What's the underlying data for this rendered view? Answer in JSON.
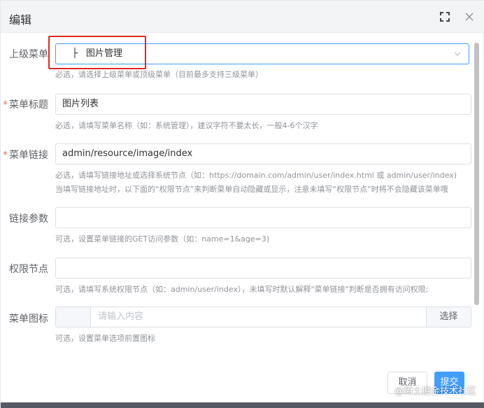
{
  "dialog": {
    "title": "编辑",
    "fullscreen_icon": "fullscreen-icon",
    "close_icon": "close-icon"
  },
  "form": {
    "parent_menu": {
      "label": "上级菜单",
      "tree_prefix": "├",
      "value": "图片管理",
      "hint": "必选，请选择上级菜单或顶级菜单（目前最多支持三级菜单）",
      "arrow_icon": "chevron-down-icon"
    },
    "menu_title": {
      "label": "菜单标题",
      "required": "*",
      "value": "图片列表",
      "hint": "必选，请填写菜单名称（如：系统管理），建议字符不要太长，一般4-6个汉字"
    },
    "menu_link": {
      "label": "菜单链接",
      "required": "*",
      "value": "admin/resource/image/index",
      "hint1": "必选，请填写链接地址或选择系统节点（如：https://domain.com/admin/user/index.html 或 admin/user/index)",
      "hint2": "当填写链接地址时，以下面的“权限节点”来判断菜单自动隐藏或显示，注意未填写“权限节点”时将不会隐藏该菜单哦"
    },
    "link_params": {
      "label": "链接参数",
      "value": "",
      "hint": "可选，设置菜单链接的GET访问参数（如：name=1&age=3)"
    },
    "auth_node": {
      "label": "权限节点",
      "value": "",
      "hint": "可选，请填写系统权限节点（如：admin/user/index），未填写时默认解释\"菜单链接\"判断是否拥有访问权限;"
    },
    "menu_icon": {
      "label": "菜单图标",
      "placeholder": "请输入内容",
      "button_label": "选择",
      "hint": "可选，设置菜单选项前置图标"
    }
  },
  "footer": {
    "cancel_label": "取消",
    "submit_label": "提交"
  },
  "watermark": "@稀土掘金技术社区",
  "colors": {
    "primary": "#409eff",
    "required": "#f56c6c",
    "annotation": "#e0281e"
  }
}
